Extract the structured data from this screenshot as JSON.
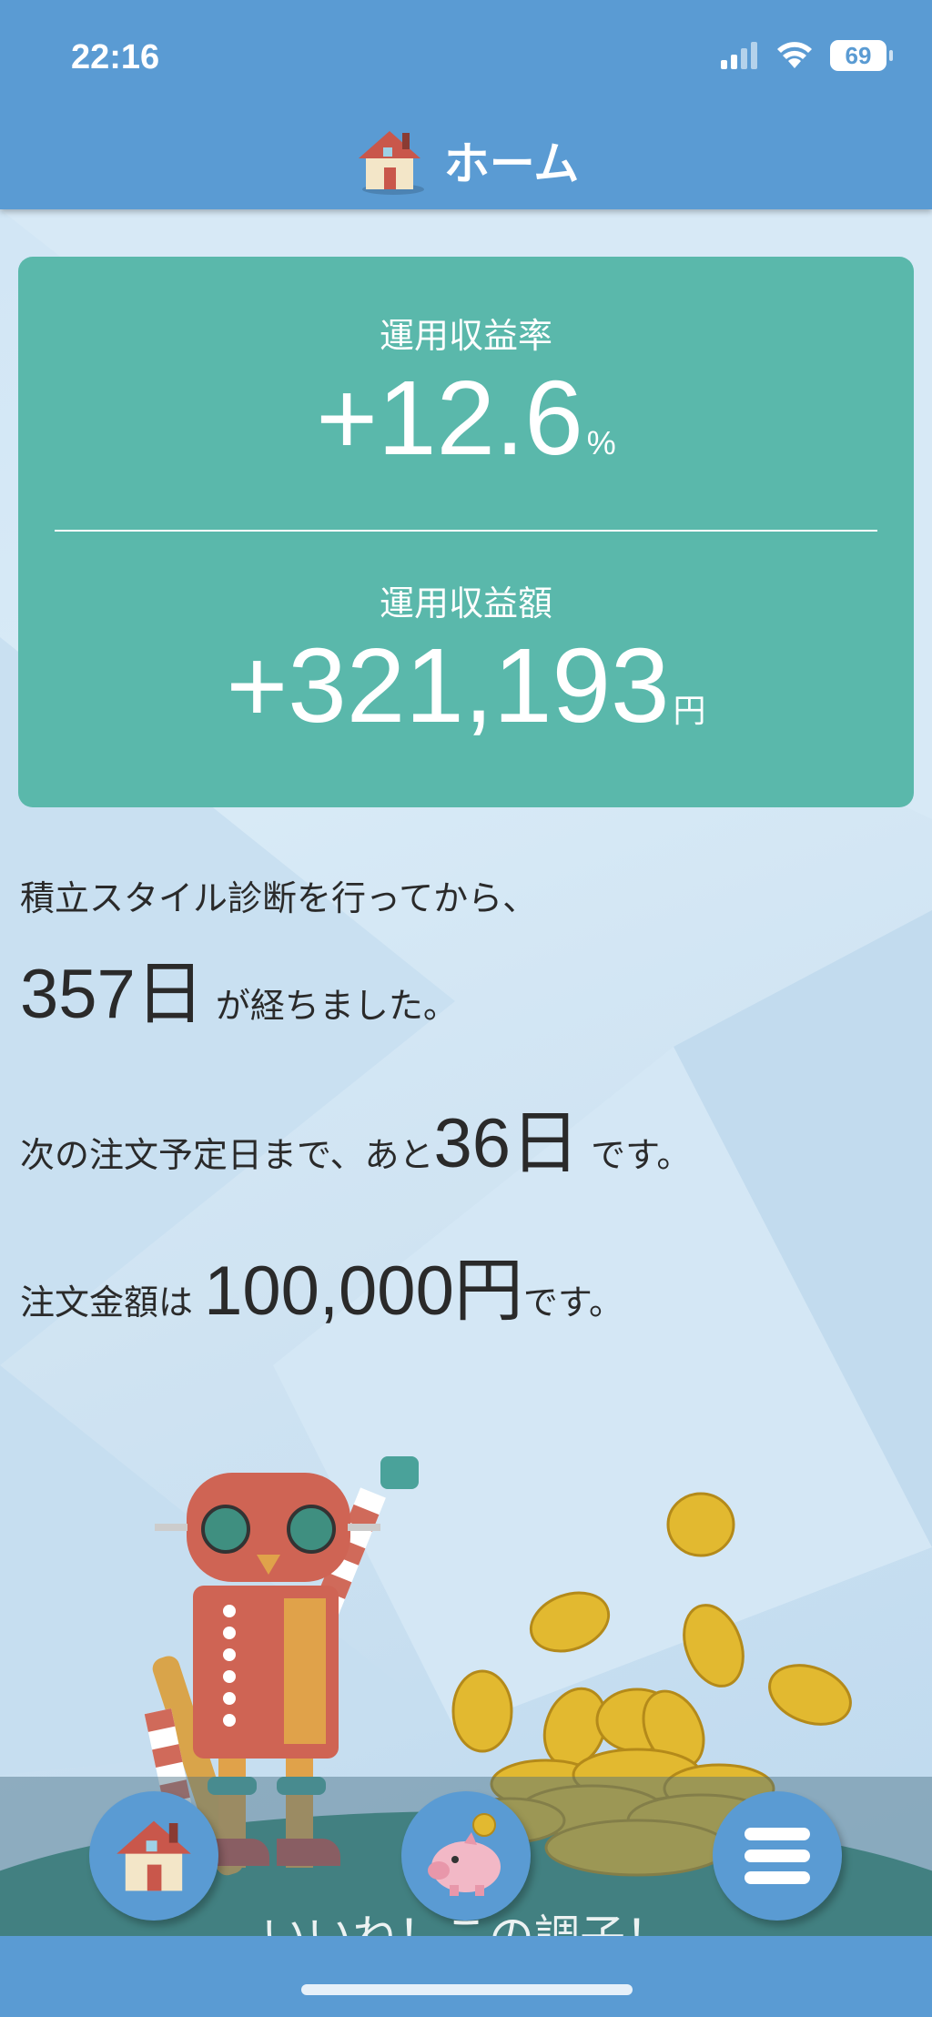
{
  "status_bar": {
    "time": "22:16",
    "battery": "69"
  },
  "header": {
    "title": "ホーム"
  },
  "summary": {
    "rate_label": "運用収益率",
    "rate_value": "+12.6",
    "rate_unit": "%",
    "amount_label": "運用収益額",
    "amount_value": "+321,193",
    "amount_unit": "円"
  },
  "info": {
    "line1": "積立スタイル診断を行ってから、",
    "days_elapsed": "357日",
    "days_suffix": "が経ちました。",
    "next_prefix": "次の注文予定日まで、あと",
    "next_days": "36日",
    "next_suffix": "です。",
    "order_prefix": "注文金額は",
    "order_amount": "100,000円",
    "order_suffix": "です。"
  },
  "bottom": {
    "ticker_text": "いいね！この調子！"
  },
  "icons": [
    "house-icon",
    "piggy-bank-icon",
    "menu-icon",
    "signal-icon",
    "wifi-icon",
    "battery-icon"
  ],
  "colors": {
    "header": "#5a9bd3",
    "card": "#5ab8ab",
    "text": "#2a2a2a"
  }
}
